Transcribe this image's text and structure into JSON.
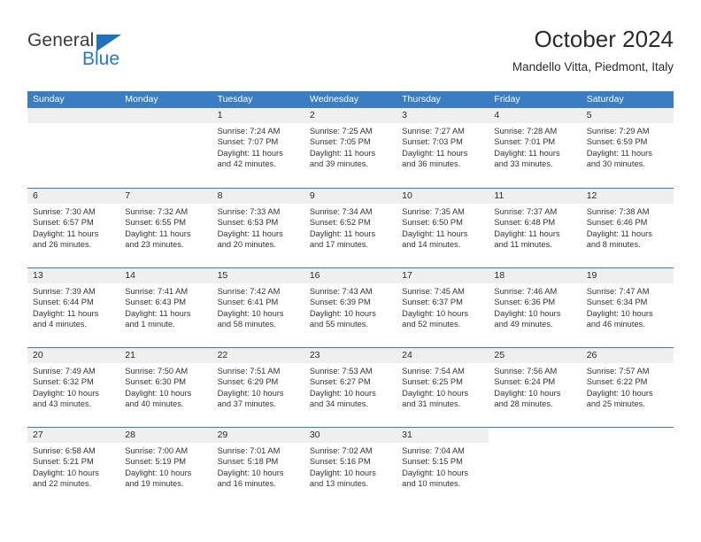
{
  "brand": {
    "name_top": "General",
    "name_bottom": "Blue",
    "color_blue": "#1f79c8",
    "triangle_icon": "triangle-logo-icon"
  },
  "header": {
    "title": "October 2024",
    "subtitle": "Mandello Vitta, Piedmont, Italy"
  },
  "theme": {
    "header_blue": "#3a7dc2",
    "band_gray": "#efefef",
    "text": "#333333"
  },
  "weekdays": [
    "Sunday",
    "Monday",
    "Tuesday",
    "Wednesday",
    "Thursday",
    "Friday",
    "Saturday"
  ],
  "weeks": [
    [
      {
        "day": "",
        "blank": false,
        "lines": []
      },
      {
        "day": "",
        "blank": false,
        "lines": []
      },
      {
        "day": "1",
        "lines": [
          "Sunrise: 7:24 AM",
          "Sunset: 7:07 PM",
          "Daylight: 11 hours",
          "and 42 minutes."
        ]
      },
      {
        "day": "2",
        "lines": [
          "Sunrise: 7:25 AM",
          "Sunset: 7:05 PM",
          "Daylight: 11 hours",
          "and 39 minutes."
        ]
      },
      {
        "day": "3",
        "lines": [
          "Sunrise: 7:27 AM",
          "Sunset: 7:03 PM",
          "Daylight: 11 hours",
          "and 36 minutes."
        ]
      },
      {
        "day": "4",
        "lines": [
          "Sunrise: 7:28 AM",
          "Sunset: 7:01 PM",
          "Daylight: 11 hours",
          "and 33 minutes."
        ]
      },
      {
        "day": "5",
        "lines": [
          "Sunrise: 7:29 AM",
          "Sunset: 6:59 PM",
          "Daylight: 11 hours",
          "and 30 minutes."
        ]
      }
    ],
    [
      {
        "day": "6",
        "lines": [
          "Sunrise: 7:30 AM",
          "Sunset: 6:57 PM",
          "Daylight: 11 hours",
          "and 26 minutes."
        ]
      },
      {
        "day": "7",
        "lines": [
          "Sunrise: 7:32 AM",
          "Sunset: 6:55 PM",
          "Daylight: 11 hours",
          "and 23 minutes."
        ]
      },
      {
        "day": "8",
        "lines": [
          "Sunrise: 7:33 AM",
          "Sunset: 6:53 PM",
          "Daylight: 11 hours",
          "and 20 minutes."
        ]
      },
      {
        "day": "9",
        "lines": [
          "Sunrise: 7:34 AM",
          "Sunset: 6:52 PM",
          "Daylight: 11 hours",
          "and 17 minutes."
        ]
      },
      {
        "day": "10",
        "lines": [
          "Sunrise: 7:35 AM",
          "Sunset: 6:50 PM",
          "Daylight: 11 hours",
          "and 14 minutes."
        ]
      },
      {
        "day": "11",
        "lines": [
          "Sunrise: 7:37 AM",
          "Sunset: 6:48 PM",
          "Daylight: 11 hours",
          "and 11 minutes."
        ]
      },
      {
        "day": "12",
        "lines": [
          "Sunrise: 7:38 AM",
          "Sunset: 6:46 PM",
          "Daylight: 11 hours",
          "and 8 minutes."
        ]
      }
    ],
    [
      {
        "day": "13",
        "lines": [
          "Sunrise: 7:39 AM",
          "Sunset: 6:44 PM",
          "Daylight: 11 hours",
          "and 4 minutes."
        ]
      },
      {
        "day": "14",
        "lines": [
          "Sunrise: 7:41 AM",
          "Sunset: 6:43 PM",
          "Daylight: 11 hours",
          "and 1 minute."
        ]
      },
      {
        "day": "15",
        "lines": [
          "Sunrise: 7:42 AM",
          "Sunset: 6:41 PM",
          "Daylight: 10 hours",
          "and 58 minutes."
        ]
      },
      {
        "day": "16",
        "lines": [
          "Sunrise: 7:43 AM",
          "Sunset: 6:39 PM",
          "Daylight: 10 hours",
          "and 55 minutes."
        ]
      },
      {
        "day": "17",
        "lines": [
          "Sunrise: 7:45 AM",
          "Sunset: 6:37 PM",
          "Daylight: 10 hours",
          "and 52 minutes."
        ]
      },
      {
        "day": "18",
        "lines": [
          "Sunrise: 7:46 AM",
          "Sunset: 6:36 PM",
          "Daylight: 10 hours",
          "and 49 minutes."
        ]
      },
      {
        "day": "19",
        "lines": [
          "Sunrise: 7:47 AM",
          "Sunset: 6:34 PM",
          "Daylight: 10 hours",
          "and 46 minutes."
        ]
      }
    ],
    [
      {
        "day": "20",
        "lines": [
          "Sunrise: 7:49 AM",
          "Sunset: 6:32 PM",
          "Daylight: 10 hours",
          "and 43 minutes."
        ]
      },
      {
        "day": "21",
        "lines": [
          "Sunrise: 7:50 AM",
          "Sunset: 6:30 PM",
          "Daylight: 10 hours",
          "and 40 minutes."
        ]
      },
      {
        "day": "22",
        "lines": [
          "Sunrise: 7:51 AM",
          "Sunset: 6:29 PM",
          "Daylight: 10 hours",
          "and 37 minutes."
        ]
      },
      {
        "day": "23",
        "lines": [
          "Sunrise: 7:53 AM",
          "Sunset: 6:27 PM",
          "Daylight: 10 hours",
          "and 34 minutes."
        ]
      },
      {
        "day": "24",
        "lines": [
          "Sunrise: 7:54 AM",
          "Sunset: 6:25 PM",
          "Daylight: 10 hours",
          "and 31 minutes."
        ]
      },
      {
        "day": "25",
        "lines": [
          "Sunrise: 7:56 AM",
          "Sunset: 6:24 PM",
          "Daylight: 10 hours",
          "and 28 minutes."
        ]
      },
      {
        "day": "26",
        "lines": [
          "Sunrise: 7:57 AM",
          "Sunset: 6:22 PM",
          "Daylight: 10 hours",
          "and 25 minutes."
        ]
      }
    ],
    [
      {
        "day": "27",
        "lines": [
          "Sunrise: 6:58 AM",
          "Sunset: 5:21 PM",
          "Daylight: 10 hours",
          "and 22 minutes."
        ]
      },
      {
        "day": "28",
        "lines": [
          "Sunrise: 7:00 AM",
          "Sunset: 5:19 PM",
          "Daylight: 10 hours",
          "and 19 minutes."
        ]
      },
      {
        "day": "29",
        "lines": [
          "Sunrise: 7:01 AM",
          "Sunset: 5:18 PM",
          "Daylight: 10 hours",
          "and 16 minutes."
        ]
      },
      {
        "day": "30",
        "lines": [
          "Sunrise: 7:02 AM",
          "Sunset: 5:16 PM",
          "Daylight: 10 hours",
          "and 13 minutes."
        ]
      },
      {
        "day": "31",
        "lines": [
          "Sunrise: 7:04 AM",
          "Sunset: 5:15 PM",
          "Daylight: 10 hours",
          "and 10 minutes."
        ]
      },
      {
        "day": "",
        "blank": true,
        "lines": []
      },
      {
        "day": "",
        "blank": true,
        "lines": []
      }
    ]
  ]
}
